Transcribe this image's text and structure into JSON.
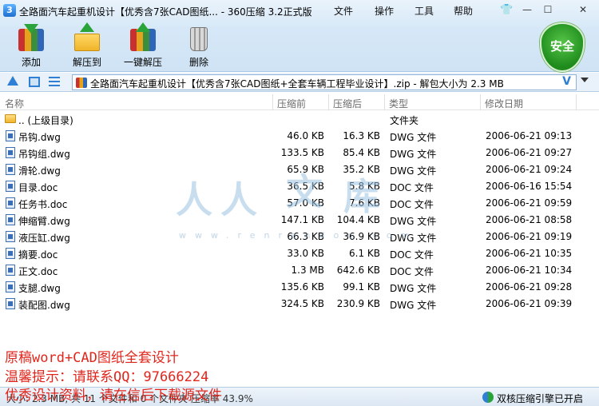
{
  "window": {
    "title": "全路面汽车起重机设计【优秀含7张CAD图纸... - 360压缩 3.2正式版",
    "menus": [
      "文件",
      "操作",
      "工具",
      "帮助"
    ],
    "controls": [
      "—",
      "☐",
      "✕"
    ]
  },
  "toolbar": {
    "add": "添加",
    "extract": "解压到",
    "oneclick": "一键解压",
    "delete": "删除",
    "security": "安全"
  },
  "address": {
    "path": "全路面汽车起重机设计【优秀含7张CAD图纸+全套车辆工程毕业设计】.zip - 解包大小为 2.3 MB",
    "v": "V"
  },
  "columns": {
    "name": "名称",
    "compressed": "压缩前",
    "size": "压缩后",
    "type": "类型",
    "date": "修改日期"
  },
  "parent": {
    "name": ".. (上级目录)",
    "type": "文件夹"
  },
  "files": [
    {
      "name": "吊钩.dwg",
      "before": "46.0 KB",
      "after": "16.3 KB",
      "type": "DWG 文件",
      "date": "2006-06-21 09:13"
    },
    {
      "name": "吊钩组.dwg",
      "before": "133.5 KB",
      "after": "85.4 KB",
      "type": "DWG 文件",
      "date": "2006-06-21 09:27"
    },
    {
      "name": "滑轮.dwg",
      "before": "65.9 KB",
      "after": "35.2 KB",
      "type": "DWG 文件",
      "date": "2006-06-21 09:24"
    },
    {
      "name": "目录.doc",
      "before": "36.5 KB",
      "after": "5.8 KB",
      "type": "DOC 文件",
      "date": "2006-06-16 15:54"
    },
    {
      "name": "任务书.doc",
      "before": "57.0 KB",
      "after": "7.6 KB",
      "type": "DOC 文件",
      "date": "2006-06-21 09:59"
    },
    {
      "name": "伸缩臂.dwg",
      "before": "147.1 KB",
      "after": "104.4 KB",
      "type": "DWG 文件",
      "date": "2006-06-21 08:58"
    },
    {
      "name": "液压缸.dwg",
      "before": "66.3 KB",
      "after": "36.9 KB",
      "type": "DWG 文件",
      "date": "2006-06-21 09:19"
    },
    {
      "name": "摘要.doc",
      "before": "33.0 KB",
      "after": "6.1 KB",
      "type": "DOC 文件",
      "date": "2006-06-21 10:35"
    },
    {
      "name": "正文.doc",
      "before": "1.3 MB",
      "after": "642.6 KB",
      "type": "DOC 文件",
      "date": "2006-06-21 10:34"
    },
    {
      "name": "支腿.dwg",
      "before": "135.6 KB",
      "after": "99.1 KB",
      "type": "DWG 文件",
      "date": "2006-06-21 09:28"
    },
    {
      "name": "装配图.dwg",
      "before": "324.5 KB",
      "after": "230.9 KB",
      "type": "DWG 文件",
      "date": "2006-06-21 09:39"
    }
  ],
  "watermark": {
    "chars": [
      "人",
      "人",
      "文",
      "库"
    ],
    "url": "www.renrendoc.com"
  },
  "overlay": [
    "原稿word+CAD图纸全套设计",
    "温馨提示：请联系QQ：97666224",
    "优秀设计资料，请在信后下载源文件"
  ],
  "status": {
    "left": "大小: 2.3 MB, 共 11 个文件和 0 个文件夹 压缩率 43.9%",
    "right": "双核压缩引擎已开启"
  }
}
